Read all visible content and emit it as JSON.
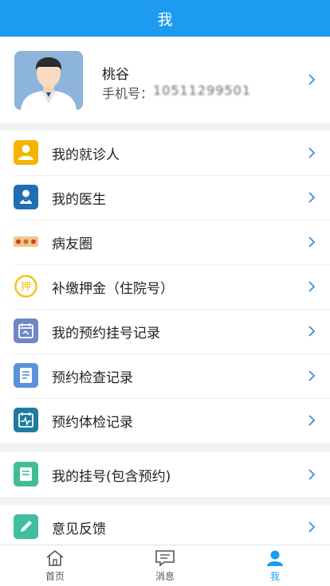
{
  "header": {
    "title": "我"
  },
  "profile": {
    "name": "桃谷",
    "phone_label": "手机号：",
    "phone_value": "10511299501"
  },
  "menu_group_1": [
    {
      "label": "我的就诊人",
      "icon": "patient-icon",
      "color": "#f5b400"
    },
    {
      "label": "我的医生",
      "icon": "doctor-icon",
      "color": "#1f6fb2"
    },
    {
      "label": "病友圈",
      "icon": "community-icon",
      "color": "#e8a642"
    },
    {
      "label": "补缴押金（住院号）",
      "icon": "deposit-icon",
      "color": "#f3c51a"
    },
    {
      "label": "我的预约挂号记录",
      "icon": "calendar-icon",
      "color": "#6f86c7"
    },
    {
      "label": "预约检查记录",
      "icon": "exam-record-icon",
      "color": "#5b93d8"
    },
    {
      "label": "预约体检记录",
      "icon": "health-check-icon",
      "color": "#1f7aa0"
    }
  ],
  "menu_group_2": [
    {
      "label": "我的挂号(包含预约)",
      "icon": "registration-icon",
      "color": "#3fbf8f"
    }
  ],
  "menu_group_3": [
    {
      "label": "意见反馈",
      "icon": "feedback-icon",
      "color": "#3fbf9f"
    }
  ],
  "tabbar": [
    {
      "label": "首页",
      "icon": "home-icon",
      "active": false
    },
    {
      "label": "消息",
      "icon": "message-icon",
      "active": false
    },
    {
      "label": "我",
      "icon": "user-icon",
      "active": true
    }
  ],
  "colors": {
    "accent": "#1d9bf0",
    "chevron": "#3a8fd8"
  }
}
